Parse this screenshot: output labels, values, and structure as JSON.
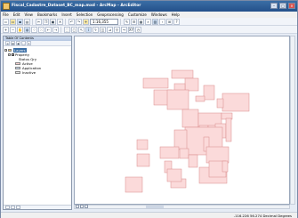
{
  "window": {
    "title": "Fiscal_Cadastre_Dataset_BC_map.mxd - ArcMap - ArcEditor",
    "buttons": {
      "minimize": "–",
      "maximize": "□",
      "close": "×"
    }
  },
  "menu": [
    "File",
    "Edit",
    "View",
    "Bookmarks",
    "Insert",
    "Selection",
    "Geoprocessing",
    "Customize",
    "Windows",
    "Help"
  ],
  "toolbar": {
    "scale": "1:16,355"
  },
  "toc": {
    "header": "Table Of Contents",
    "frame": "Layers",
    "layer": "Property",
    "field": "Status Qry",
    "legend": [
      {
        "label": "Active",
        "color": "#f9d2d2"
      },
      {
        "label": "Application",
        "color": "#c9dcf3"
      },
      {
        "label": "Inactive",
        "color": "#e6e6e6"
      }
    ]
  },
  "map": {
    "fill": "#fbdada",
    "stroke": "#d98b8b"
  },
  "status": {
    "coords": "-116.226 56.274 Decimal Degrees"
  }
}
